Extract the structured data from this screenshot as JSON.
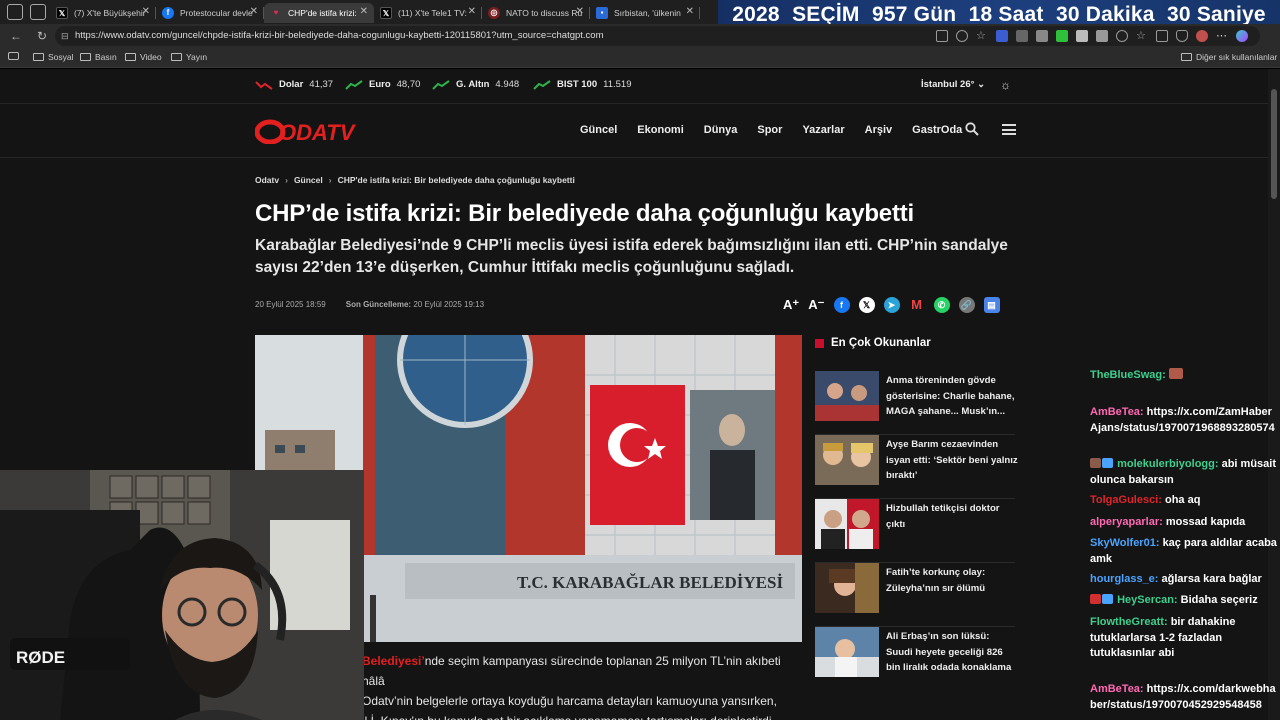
{
  "browser": {
    "tabs": [
      {
        "label": "(7) X'te Büyükşehir",
        "icon": "x-logo",
        "color": "#000000"
      },
      {
        "label": "Protestocular devle",
        "icon": "facebook-logo",
        "color": "#1877f2"
      },
      {
        "label": "CHP'de istifa krizi:",
        "icon": "odatv-logo",
        "color": "#e32a4a",
        "active": true
      },
      {
        "label": "(11) X'te Tele1 TV:",
        "icon": "x-logo",
        "color": "#000000"
      },
      {
        "label": "NATO to discuss Ru",
        "icon": "chatgpt-logo",
        "color": "#7a1f1f"
      },
      {
        "label": "Sırbistan, 'ülkenin",
        "icon": "news-logo",
        "color": "#2a6ad8"
      }
    ],
    "url": "https://www.odatv.com/guncel/chpde-istifa-krizi-bir-belediyede-daha-cogunlugu-kaybetti-120115801?utm_source=chatgpt.com",
    "bookmarks": [
      "Sosyal",
      "Basın",
      "Video",
      "Yayın"
    ],
    "other_bookmarks": "Diğer sık kullanılanlar"
  },
  "countdown": {
    "year": "2028",
    "label": "SEÇİM",
    "days": "957 Gün",
    "hours": "18 Saat",
    "minutes": "30 Dakika",
    "seconds": "30 Saniye"
  },
  "ticker": [
    {
      "name": "Dolar",
      "value": "41,37",
      "trend": "down",
      "color": "#e0242b"
    },
    {
      "name": "Euro",
      "value": "48,70",
      "trend": "up",
      "color": "#2db34a"
    },
    {
      "name": "G. Altın",
      "value": "4.948",
      "trend": "up",
      "color": "#2db34a"
    },
    {
      "name": "BIST 100",
      "value": "11.519",
      "trend": "up",
      "color": "#2db34a"
    }
  ],
  "weather": "İstanbul 26°",
  "site": {
    "logo_text": "ODATV",
    "brand_color": "#e32020",
    "nav": [
      "Güncel",
      "Ekonomi",
      "Dünya",
      "Spor",
      "Yazarlar",
      "Arşiv",
      "GastrOda"
    ]
  },
  "article": {
    "breadcrumb": [
      "Odatv",
      "Güncel",
      "CHP'de istifa krizi: Bir belediyede daha çoğunluğu kaybetti"
    ],
    "title": "CHP’de istifa krizi: Bir belediyede daha çoğunluğu kaybetti",
    "summary": "Karabağlar Belediyesi’nde 9 CHP’li meclis üyesi istifa ederek bağımsızlığını ilan etti. CHP’nin sandalye sayısı 22’den 13’e düşerken, Cumhur İttifakı meclis çoğunluğunu sağladı.",
    "published": "20 Eylül 2025 18:59",
    "updated_label": "Son Güncelleme:",
    "updated": "20 Eylül 2025 19:13",
    "font_up": "A⁺",
    "font_down": "A⁻",
    "photo_sign": "T.C. KARABAĞLAR BELEDİYESİ",
    "body_line1_highlight": "Belediyesi’",
    "body_line1_rest": "nde seçim kampanyası sürecinde toplanan 25 milyon TL’nin akıbeti hâlâ",
    "body_line2": "Odatv’nin belgelerle ortaya koyduğu harcama detayları kamuoyuna yansırken,",
    "body_line3": "il İ. Kınay’ın bu konuda net bir açıklama yapamaması tartışmaları derinleştirdi."
  },
  "popular": {
    "title": "En Çok Okunanlar",
    "items": [
      "Anma töreninden gövde gösterisine: Charlie bahane, MAGA şahane... Musk’ın...",
      "Ayşe Barım cezaevinden isyan etti: ‘Sektör beni yalnız bıraktı’",
      "Hizbullah tetikçisi doktor çıktı",
      "Fatih’te korkunç olay: Züleyha’nın sır ölümü",
      "Ali Erbaş’ın son lüksü: Suudi heyete geceliği 826 bin liralık odada konaklama"
    ]
  },
  "chat": [
    {
      "user": "TheBlueSwag:",
      "text": "",
      "color": "#3ecf8e"
    },
    {
      "user": "AmBeTea:",
      "text": "https://x.com/ZamHaberAjans/status/1970071968893280574",
      "color": "#ff69b4"
    },
    {
      "user": "molekulerbiyologg:",
      "text": "abi müsait olunca bakarsın",
      "color": "#3ecf8e"
    },
    {
      "user": "TolgaGulesci:",
      "text": "oha aq",
      "color": "#e0242b"
    },
    {
      "user": "alperyaparlar:",
      "text": "mossad kapıda",
      "color": "#ff69b4"
    },
    {
      "user": "SkyWolfer01:",
      "text": "kaç para aldılar acaba amk",
      "color": "#4aa3ff"
    },
    {
      "user": "hourglass_e:",
      "text": "ağlarsa kara bağlar",
      "color": "#4aa3ff"
    },
    {
      "user": "HeySercan:",
      "text": "Bidaha seçeriz",
      "color": "#3ecf8e"
    },
    {
      "user": "FlowtheGreatt:",
      "text": "bir dahakine tutuklarlarsa 1-2 fazladan tutuklasınlar abi",
      "color": "#3ecf8e"
    },
    {
      "user": "AmBeTea:",
      "text": "https://x.com/darkwebhaber/status/1970070452929548458",
      "color": "#ff69b4"
    }
  ],
  "webcam": {
    "mic_brand": "RØDE"
  }
}
